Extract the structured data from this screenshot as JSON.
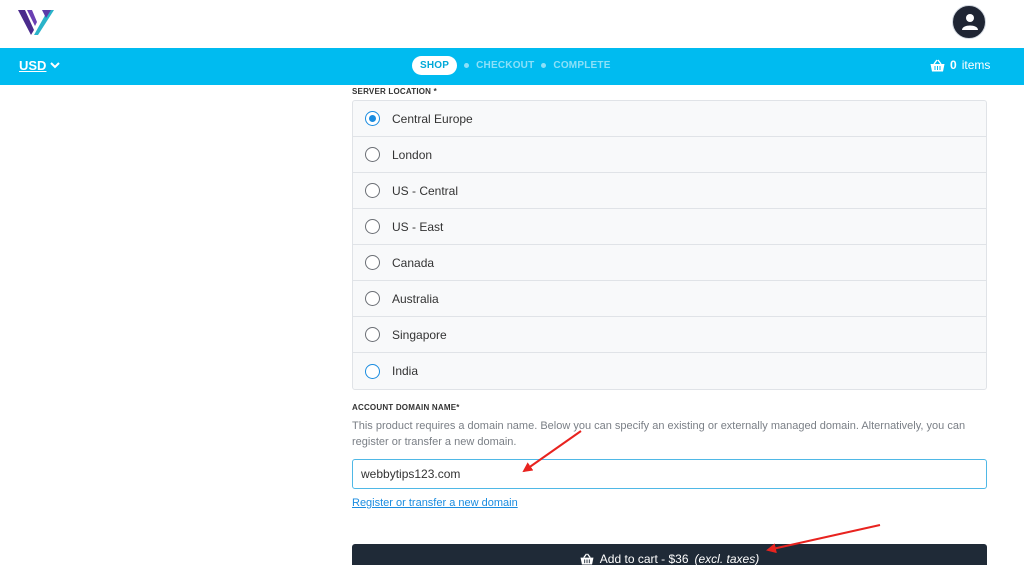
{
  "header": {
    "currency": "USD",
    "steps": {
      "shop": "SHOP",
      "checkout": "CHECKOUT",
      "complete": "COMPLETE"
    },
    "cart": {
      "count": "0",
      "label": "items"
    }
  },
  "server_location": {
    "label": "SERVER LOCATION *",
    "options": [
      "Central Europe",
      "London",
      "US - Central",
      "US - East",
      "Canada",
      "Australia",
      "Singapore",
      "India"
    ],
    "selected": "Central Europe"
  },
  "domain": {
    "label": "ACCOUNT DOMAIN NAME*",
    "description": "This product requires a domain name. Below you can specify an existing or externally managed domain. Alternatively, you can register or transfer a new domain.",
    "value": "webbytips123.com",
    "register_link": "Register or transfer a new domain"
  },
  "add_to_cart": {
    "prefix": "Add to cart - $36",
    "suffix": "(excl. taxes)"
  },
  "colors": {
    "nav_bar": "#00bbf0",
    "button_dark": "#1f2a37",
    "annotation_arrow": "#e8231f",
    "logo_purple": "#4a2b8c",
    "logo_teal": "#2ab3c9"
  }
}
